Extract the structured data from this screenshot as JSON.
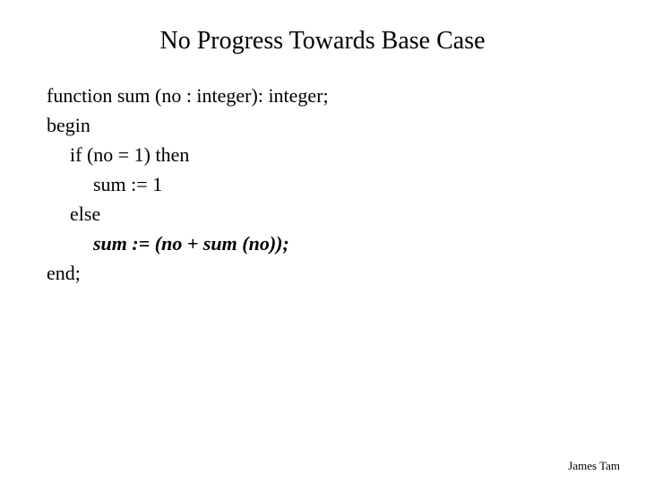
{
  "title": "No Progress Towards Base Case",
  "code": {
    "line1": "function sum (no : integer): integer;",
    "line2": "begin",
    "line3": "if (no = 1) then",
    "line4": "sum := 1",
    "line5": "else",
    "line6": "sum := (no + sum (no));",
    "line7": "end;"
  },
  "footer": "James Tam"
}
